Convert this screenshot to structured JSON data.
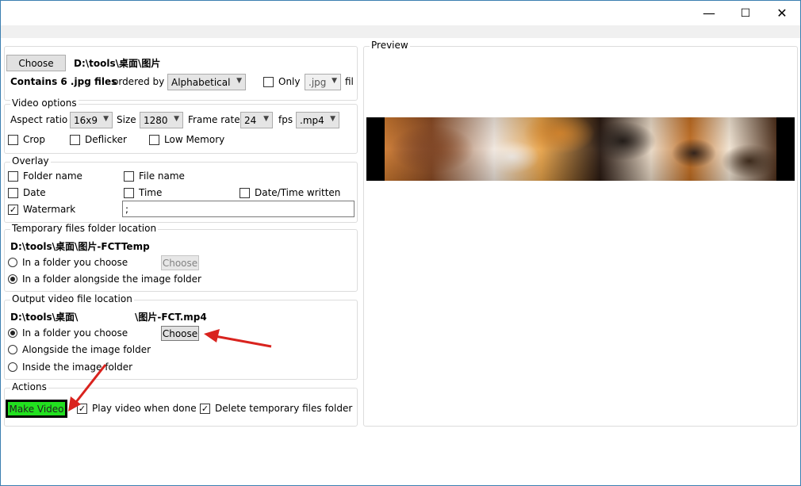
{
  "window": {
    "minimize_glyph": "—",
    "maximize_glyph": "☐",
    "close_glyph": "✕"
  },
  "source": {
    "choose_label": "Choose",
    "path": "D:\\tools\\桌面\\图片",
    "contains_text": "Contains 6 .jpg files",
    "ordered_by_label": "ordered by",
    "order_value": "Alphabetical",
    "only_label": "Only",
    "only_ext": ".jpg",
    "fil_label": "fil"
  },
  "video_options": {
    "title": "Video options",
    "aspect_label": "Aspect ratio",
    "aspect_value": "16x9",
    "size_label": "Size",
    "size_value": "1280",
    "framerate_label": "Frame rate",
    "framerate_value": "24",
    "fps_label": "fps",
    "format_value": ".mp4",
    "crop_label": "Crop",
    "deflicker_label": "Deflicker",
    "lowmem_label": "Low Memory"
  },
  "overlay": {
    "title": "Overlay",
    "folder_name_label": "Folder name",
    "file_name_label": "File name",
    "date_label": "Date",
    "time_label": "Time",
    "datetime_written_label": "Date/Time written",
    "watermark_label": "Watermark",
    "watermark_value": ";",
    "watermark_checked": "✓"
  },
  "temp_folder": {
    "title": "Temporary files folder location",
    "path": "D:\\tools\\桌面\\图片-FCTTemp",
    "option1_label": "In a folder you choose",
    "option2_label": "In a folder alongside the image folder",
    "choose_label": "Choose"
  },
  "output": {
    "title": "Output video file location",
    "path_left": "D:\\tools\\桌面\\",
    "path_right": "\\图片-FCT.mp4",
    "option1_label": "In a folder you choose",
    "option2_label": "Alongside the image folder",
    "option3_label": "Inside the image folder",
    "choose_label": "Choose"
  },
  "actions": {
    "title": "Actions",
    "make_video_label": "Make Video",
    "play_when_done_label": "Play video when done",
    "delete_temp_label": "Delete temporary files folder",
    "checked_glyph": "✓"
  },
  "preview": {
    "title": "Preview"
  },
  "colors": {
    "make_video_bg": "#22e01f",
    "annotation_arrow": "#d9231e",
    "window_border": "#3c7fb1"
  }
}
